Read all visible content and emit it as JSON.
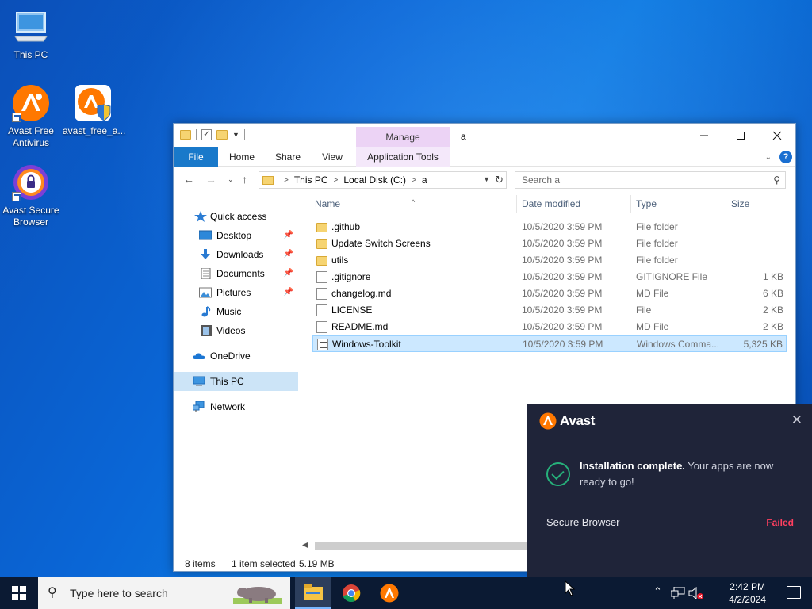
{
  "desktop": {
    "icons": [
      {
        "label": "This PC",
        "icon": "computer-icon"
      },
      {
        "label": "Avast Free Antivirus",
        "icon": "avast-logo-icon"
      },
      {
        "label": "avast_free_a...",
        "icon": "avast-installer-icon"
      },
      {
        "label": "Avast Secure Browser",
        "icon": "avast-secure-browser-icon"
      }
    ]
  },
  "explorer": {
    "manage_tab": "Manage",
    "window_title": "a",
    "ribbon_tabs": [
      "File",
      "Home",
      "Share",
      "View",
      "Application Tools"
    ],
    "address": {
      "segments": [
        "This PC",
        "Local Disk (C:)",
        "a"
      ]
    },
    "search_placeholder": "Search a",
    "nav": [
      {
        "label": "Quick access",
        "icon": "star-icon",
        "pinned": false
      },
      {
        "label": "Desktop",
        "icon": "desktop-folder-icon",
        "pinned": true
      },
      {
        "label": "Downloads",
        "icon": "download-arrow-icon",
        "pinned": true
      },
      {
        "label": "Documents",
        "icon": "documents-icon",
        "pinned": true
      },
      {
        "label": "Pictures",
        "icon": "pictures-icon",
        "pinned": true
      },
      {
        "label": "Music",
        "icon": "music-note-icon",
        "pinned": false
      },
      {
        "label": "Videos",
        "icon": "video-icon",
        "pinned": false
      },
      {
        "label": "OneDrive",
        "icon": "cloud-icon",
        "pinned": false
      },
      {
        "label": "This PC",
        "icon": "computer-icon",
        "pinned": false
      },
      {
        "label": "Network",
        "icon": "network-icon",
        "pinned": false
      }
    ],
    "columns": {
      "name": "Name",
      "date": "Date modified",
      "type": "Type",
      "size": "Size"
    },
    "files": [
      {
        "name": ".github",
        "date": "10/5/2020 3:59 PM",
        "type": "File folder",
        "size": "",
        "kind": "folder"
      },
      {
        "name": "Update Switch Screens",
        "date": "10/5/2020 3:59 PM",
        "type": "File folder",
        "size": "",
        "kind": "folder"
      },
      {
        "name": "utils",
        "date": "10/5/2020 3:59 PM",
        "type": "File folder",
        "size": "",
        "kind": "folder"
      },
      {
        "name": ".gitignore",
        "date": "10/5/2020 3:59 PM",
        "type": "GITIGNORE File",
        "size": "1 KB",
        "kind": "doc"
      },
      {
        "name": "changelog.md",
        "date": "10/5/2020 3:59 PM",
        "type": "MD File",
        "size": "6 KB",
        "kind": "doc"
      },
      {
        "name": "LICENSE",
        "date": "10/5/2020 3:59 PM",
        "type": "File",
        "size": "2 KB",
        "kind": "doc"
      },
      {
        "name": "README.md",
        "date": "10/5/2020 3:59 PM",
        "type": "MD File",
        "size": "2 KB",
        "kind": "doc"
      },
      {
        "name": "Windows-Toolkit",
        "date": "10/5/2020 3:59 PM",
        "type": "Windows Comma...",
        "size": "5,325 KB",
        "kind": "exe",
        "selected": true
      }
    ],
    "status": {
      "items": "8 items",
      "selected": "1 item selected",
      "size": "5.19 MB"
    }
  },
  "avast_popup": {
    "brand": "Avast",
    "message_bold": "Installation complete.",
    "message_rest": " Your apps are now ready to go!",
    "item_label": "Secure Browser",
    "item_status": "Failed",
    "status_color": "#ff3f5f"
  },
  "taskbar": {
    "search_placeholder": "Type here to search",
    "clock_time": "2:42 PM",
    "clock_date": "4/2/2024"
  }
}
